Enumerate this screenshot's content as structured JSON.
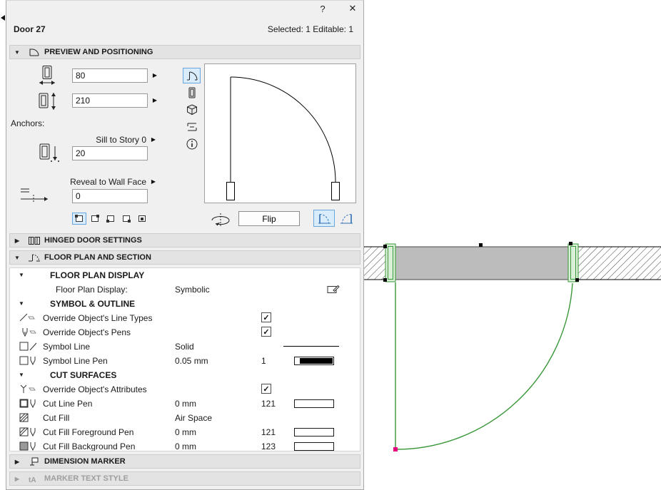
{
  "titlebar": {
    "help_label": "?",
    "close_label": "✕"
  },
  "header": {
    "title": "Door 27",
    "selection_status": "Selected: 1 Editable: 1"
  },
  "panel_sections": {
    "preview_positioning": "PREVIEW AND POSITIONING",
    "hinged_door": "HINGED DOOR SETTINGS",
    "floor_plan_section": "FLOOR PLAN AND SECTION",
    "dimension_marker": "DIMENSION MARKER",
    "marker_text_style": "MARKER TEXT STYLE"
  },
  "preview": {
    "width_value": "80",
    "height_value": "210",
    "anchors_label": "Anchors:",
    "sill_anchor_label": "Sill to Story 0",
    "sill_value": "20",
    "reveal_label": "Reveal to Wall Face",
    "reveal_value": "0",
    "flip_button": "Flip"
  },
  "parameters": {
    "group_floor_plan_display": "FLOOR PLAN DISPLAY",
    "floor_plan_display_label": "Floor Plan Display:",
    "floor_plan_display_value": "Symbolic",
    "group_symbol_outline": "SYMBOL & OUTLINE",
    "group_cut_surfaces": "CUT SURFACES",
    "rows": [
      {
        "label": "Override Object's Line Types",
        "checked": true
      },
      {
        "label": "Override Object's Pens",
        "checked": true
      },
      {
        "label": "Symbol Line",
        "value": "Solid"
      },
      {
        "label": "Symbol Line Pen",
        "value": "0.05 mm",
        "pen_number": "1"
      },
      {
        "label": "Override Object's Attributes",
        "checked": true
      },
      {
        "label": "Cut Line Pen",
        "value": "0 mm",
        "pen_number": "121"
      },
      {
        "label": "Cut Fill",
        "value": "Air Space"
      },
      {
        "label": "Cut Fill Foreground Pen",
        "value": "0 mm",
        "pen_number": "121"
      },
      {
        "label": "Cut Fill Background Pen",
        "value": "0 mm",
        "pen_number": "123"
      }
    ]
  },
  "colors": {
    "selection_green": "#389738",
    "selection_green_fill": "#d9efd7",
    "wall_fill_gray": "#bcbcbc",
    "hotspot_magenta": "#e6007e",
    "highlight_blue_bg": "#d9ecfb",
    "highlight_blue_border": "#6aa7dc"
  },
  "checkmark": "✓"
}
